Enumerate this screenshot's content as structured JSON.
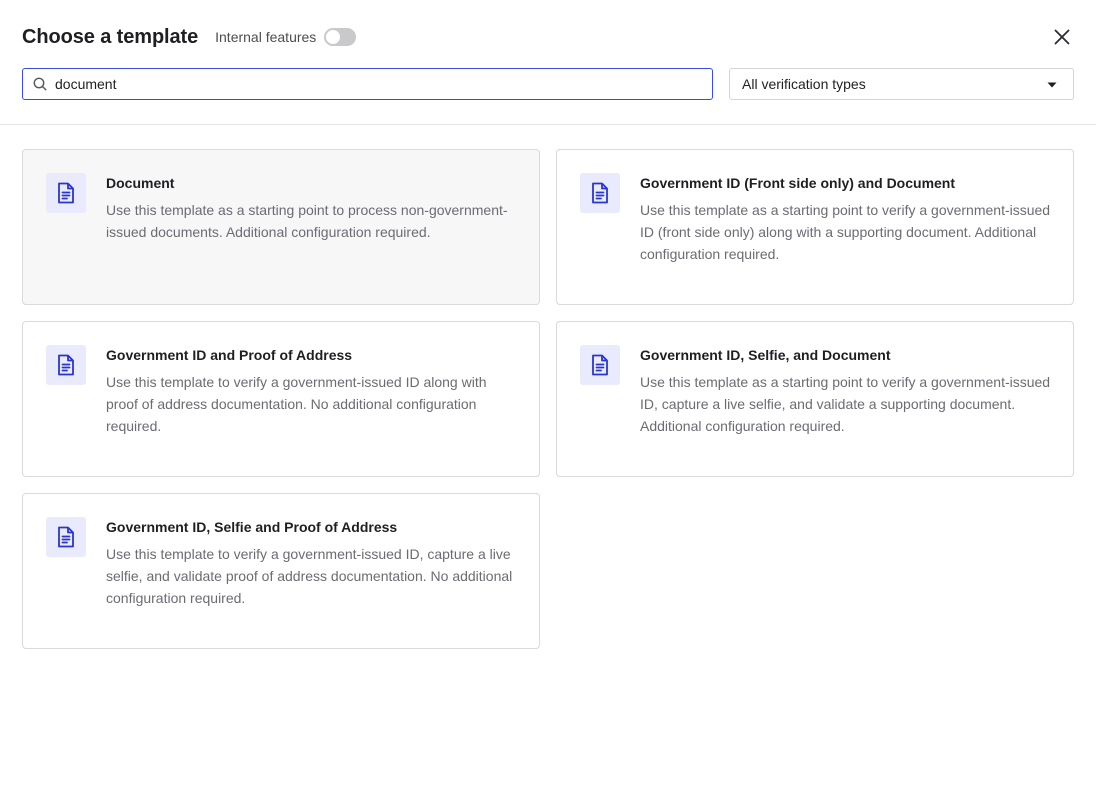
{
  "header": {
    "title": "Choose a template",
    "toggle_label": "Internal features",
    "toggle_on": false
  },
  "search": {
    "value": "document",
    "placeholder": "Search templates"
  },
  "filter": {
    "selected": "All verification types"
  },
  "colors": {
    "accent": "#3b49df",
    "icon_bg": "#e9eafc",
    "icon_fg": "#2a36c9"
  },
  "templates": [
    {
      "title": "Document",
      "description": "Use this template as a starting point to process non-government-issued documents. Additional configuration required.",
      "icon": "document-icon"
    },
    {
      "title": "Government ID (Front side only) and Document",
      "description": "Use this template as a starting point to verify a government-issued ID (front side only) along with a supporting document. Additional configuration required.",
      "icon": "document-icon"
    },
    {
      "title": "Government ID and Proof of Address",
      "description": "Use this template to verify a government-issued ID along with proof of address documentation. No additional configuration required.",
      "icon": "document-icon"
    },
    {
      "title": "Government ID, Selfie, and Document",
      "description": "Use this template as a starting point to verify a government-issued ID, capture a live selfie, and validate a supporting document. Additional configuration required.",
      "icon": "document-icon"
    },
    {
      "title": "Government ID, Selfie and Proof of Address",
      "description": "Use this template to verify a government-issued ID, capture a live selfie, and validate proof of address documentation. No additional configuration required.",
      "icon": "document-icon"
    }
  ]
}
